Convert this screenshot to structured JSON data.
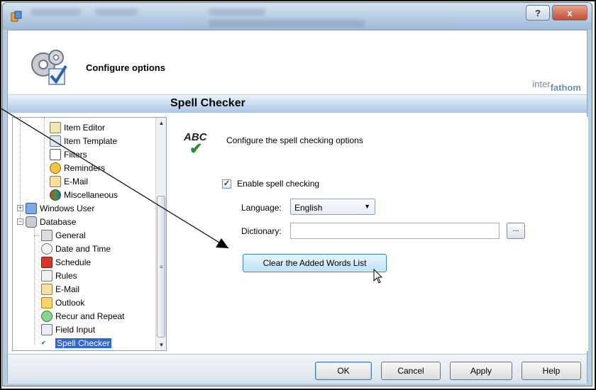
{
  "window": {
    "header_title": "Configure options",
    "brand_main": "inter",
    "brand_sub": "fathom",
    "help_glyph": "?",
    "close_glyph": "x"
  },
  "section": {
    "title": "Spell Checker"
  },
  "tree": {
    "items": [
      {
        "label": "Item Editor",
        "icon": "item-editor-icon"
      },
      {
        "label": "Item Template",
        "icon": "item-template-icon"
      },
      {
        "label": "Filters",
        "icon": "filters-icon"
      },
      {
        "label": "Reminders",
        "icon": "reminders-icon"
      },
      {
        "label": "E-Mail",
        "icon": "email-icon"
      },
      {
        "label": "Miscellaneous",
        "icon": "miscellaneous-icon"
      },
      {
        "label": "Windows User",
        "icon": "windows-user-icon"
      },
      {
        "label": "Database",
        "icon": "database-icon"
      },
      {
        "label": "General",
        "icon": "general-icon"
      },
      {
        "label": "Date and Time",
        "icon": "date-time-icon"
      },
      {
        "label": "Schedule",
        "icon": "schedule-icon"
      },
      {
        "label": "Rules",
        "icon": "rules-icon"
      },
      {
        "label": "E-Mail",
        "icon": "email-icon"
      },
      {
        "label": "Outlook",
        "icon": "outlook-icon"
      },
      {
        "label": "Recur and Repeat",
        "icon": "recur-icon"
      },
      {
        "label": "Field Input",
        "icon": "field-input-icon"
      },
      {
        "label": "Spell Checker",
        "icon": "spell-check-icon"
      }
    ],
    "selected": "Spell Checker",
    "expander_plus": "+",
    "expander_minus": "−"
  },
  "panel": {
    "abc_text": "ABC",
    "description": "Configure the spell checking options",
    "enable_checkbox": {
      "label": "Enable spell checking",
      "checked": true,
      "mark": "✓"
    },
    "language": {
      "label": "Language:",
      "value": "English"
    },
    "dictionary": {
      "label": "Dictionary:",
      "value": "",
      "browse_label": "..."
    },
    "clear_button": "Clear the Added Words List"
  },
  "footer": {
    "ok": "OK",
    "cancel": "Cancel",
    "apply": "Apply",
    "help": "Help"
  },
  "colors": {
    "selection": "#3366cc",
    "section_bar": "#a9c6e6",
    "accent_button": "#bfe2f7"
  }
}
